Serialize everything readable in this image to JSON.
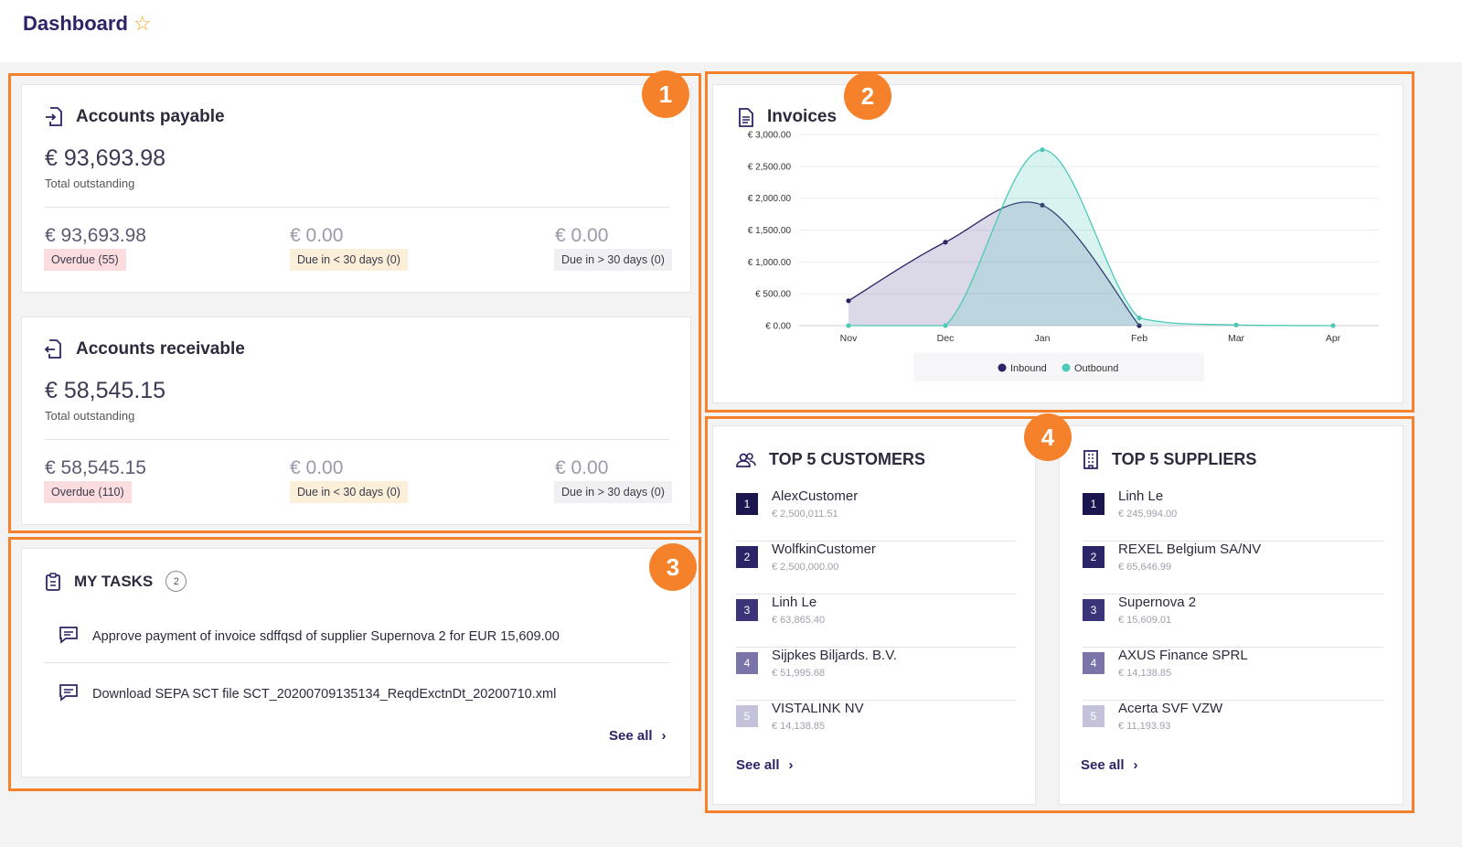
{
  "page": {
    "title": "Dashboard",
    "star_icon": "star-icon"
  },
  "annotations": [
    "1",
    "2",
    "3",
    "4"
  ],
  "accounts_payable": {
    "title": "Accounts payable",
    "icon": "file-import-icon",
    "total": "€ 93,693.98",
    "total_label": "Total outstanding",
    "overdue_amount": "€ 93,693.98",
    "overdue_label": "Overdue (55)",
    "due_lt30_amount": "€ 0.00",
    "due_lt30_label": "Due in < 30 days (0)",
    "due_gt30_amount": "€ 0.00",
    "due_gt30_label": "Due in > 30 days (0)"
  },
  "accounts_receivable": {
    "title": "Accounts receivable",
    "icon": "file-export-icon",
    "total": "€ 58,545.15",
    "total_label": "Total outstanding",
    "overdue_amount": "€ 58,545.15",
    "overdue_label": "Overdue (110)",
    "due_lt30_amount": "€ 0.00",
    "due_lt30_label": "Due in < 30 days (0)",
    "due_gt30_amount": "€ 0.00",
    "due_gt30_label": "Due in > 30 days (0)"
  },
  "tasks": {
    "title": "MY TASKS",
    "count": "2",
    "items": [
      {
        "icon": "comment-icon",
        "text": "Approve payment of invoice sdffqsd of supplier Supernova 2 for EUR 15,609.00"
      },
      {
        "icon": "comment-icon",
        "text": "Download SEPA SCT file SCT_20200709135134_ReqdExctnDt_20200710.xml"
      }
    ],
    "see_all": "See all"
  },
  "invoices": {
    "title": "Invoices",
    "icon": "document-icon"
  },
  "chart_data": {
    "type": "area",
    "title": "Invoices",
    "categories": [
      "Nov",
      "Dec",
      "Jan",
      "Feb",
      "Mar",
      "Apr"
    ],
    "y_ticks": [
      "€ 0.00",
      "€ 500.00",
      "€ 1,000.00",
      "€ 1,500.00",
      "€ 2,000.00",
      "€ 2,500.00",
      "€ 3,000.00"
    ],
    "ylim": [
      0,
      3000
    ],
    "grid": true,
    "legend_position": "bottom",
    "series": [
      {
        "name": "Inbound",
        "values": [
          390,
          1310,
          1890,
          0,
          null,
          null
        ],
        "color": "#2b2466"
      },
      {
        "name": "Outbound",
        "values": [
          0,
          0,
          2760,
          120,
          10,
          0
        ],
        "color": "#4ec9b9"
      }
    ]
  },
  "customers": {
    "title": "TOP 5 CUSTOMERS",
    "icon": "users-icon",
    "items": [
      {
        "rank": "1",
        "name": "AlexCustomer",
        "amount": "€ 2,500,011.51"
      },
      {
        "rank": "2",
        "name": "WolfkinCustomer",
        "amount": "€ 2,500,000.00"
      },
      {
        "rank": "3",
        "name": "Linh Le",
        "amount": "€ 63,865.40"
      },
      {
        "rank": "4",
        "name": "Sijpkes Biljards. B.V.",
        "amount": "€ 51,995.68"
      },
      {
        "rank": "5",
        "name": "VISTALINK NV",
        "amount": "€ 14,138.85"
      }
    ],
    "see_all": "See all"
  },
  "suppliers": {
    "title": "TOP 5 SUPPLIERS",
    "icon": "building-icon",
    "items": [
      {
        "rank": "1",
        "name": "Linh Le",
        "amount": "€ 245,994.00"
      },
      {
        "rank": "2",
        "name": "REXEL Belgium SA/NV",
        "amount": "€ 65,646.99"
      },
      {
        "rank": "3",
        "name": "Supernova 2",
        "amount": "€ 15,609.01"
      },
      {
        "rank": "4",
        "name": "AXUS Finance SPRL",
        "amount": "€ 14,138.85"
      },
      {
        "rank": "5",
        "name": "Acerta SVF VZW",
        "amount": "€ 11,193.93"
      }
    ],
    "see_all": "See all"
  },
  "rank_colors": [
    "#1c1650",
    "#2b2466",
    "#3b3478",
    "#7a74a8",
    "#c4c1da"
  ]
}
